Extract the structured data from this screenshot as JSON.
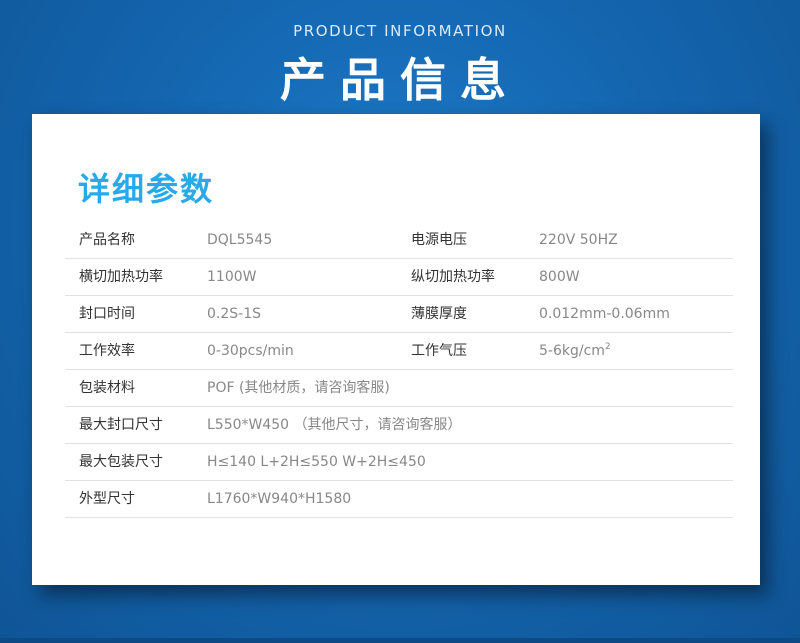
{
  "header": {
    "en_title": "PRODUCT INFORMATION",
    "cn_title": "产品信息"
  },
  "section": {
    "title": "详细参数"
  },
  "rows": [
    {
      "label1": "产品名称",
      "value1": "DQL5545",
      "label2": "电源电压",
      "value2": "220V 50HZ"
    },
    {
      "label1": "横切加热功率",
      "value1": "1100W",
      "label2": "纵切加热功率",
      "value2": "800W"
    },
    {
      "label1": "封口时间",
      "value1": "0.2S-1S",
      "label2": "薄膜厚度",
      "value2": "0.012mm-0.06mm"
    },
    {
      "label1": "工作效率",
      "value1": "0-30pcs/min",
      "label2": "工作气压",
      "value2": "5-6kg/cm",
      "value2_sup": "2"
    },
    {
      "label1": "包装材料",
      "value1": "POF (其他材质，请咨询客服)"
    },
    {
      "label1": "最大封口尺寸",
      "value1": "L550*W450  （其他尺寸，请咨询客服）"
    },
    {
      "label1": "最大包装尺寸",
      "value1": "H≤140  L+2H≤550  W+2H≤450"
    },
    {
      "label1": "外型尺寸",
      "value1": "L1760*W940*H1580"
    }
  ]
}
